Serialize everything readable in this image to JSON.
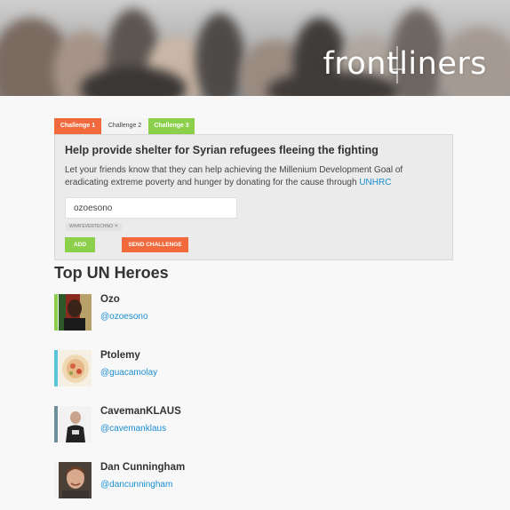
{
  "header": {
    "logo_text": "frontliners"
  },
  "challenge": {
    "tabs": [
      {
        "label": "Challenge 1",
        "color": "#f26a3c"
      },
      {
        "label": "Challenge 2",
        "color": "#f4f4f4"
      },
      {
        "label": "Challenge 3",
        "color": "#8bcf4a"
      }
    ],
    "active_tab": "Challenge 2",
    "title": "Help provide shelter for Syrian refugees fleeing the fighting",
    "description": "Let your friends know that they can help achieving the Millenium Development Goal of eradicating extreme poverty and hunger by donating for the cause through",
    "link_text": "UNHRC",
    "input_value": "ozoesono",
    "tag_label": "WHATEVERTECHNO",
    "tag_remove": "×",
    "add_label": "ADD",
    "send_label": "SEND CHALLENGE"
  },
  "heroes_section": {
    "title": "Top UN Heroes",
    "heroes": [
      {
        "name": "Ozo",
        "handle": "@ozoesono",
        "bar_color": "#8bcf4a",
        "avatar_icon": "person-photo-icon"
      },
      {
        "name": "Ptolemy",
        "handle": "@guacamolay",
        "bar_color": "#5bc4d9",
        "avatar_icon": "food-photo-icon"
      },
      {
        "name": "CavemanKLAUS",
        "handle": "@cavemanklaus",
        "bar_color": "#6c8f9b",
        "avatar_icon": "person-photo-icon"
      },
      {
        "name": "Dan Cunningham",
        "handle": "@dancunningham",
        "bar_color": "#f4f4f4",
        "avatar_icon": "person-photo-icon"
      }
    ]
  },
  "colors": {
    "accent_orange": "#f26a3c",
    "accent_green": "#8bcf4a",
    "link_blue": "#1a8ed0"
  }
}
